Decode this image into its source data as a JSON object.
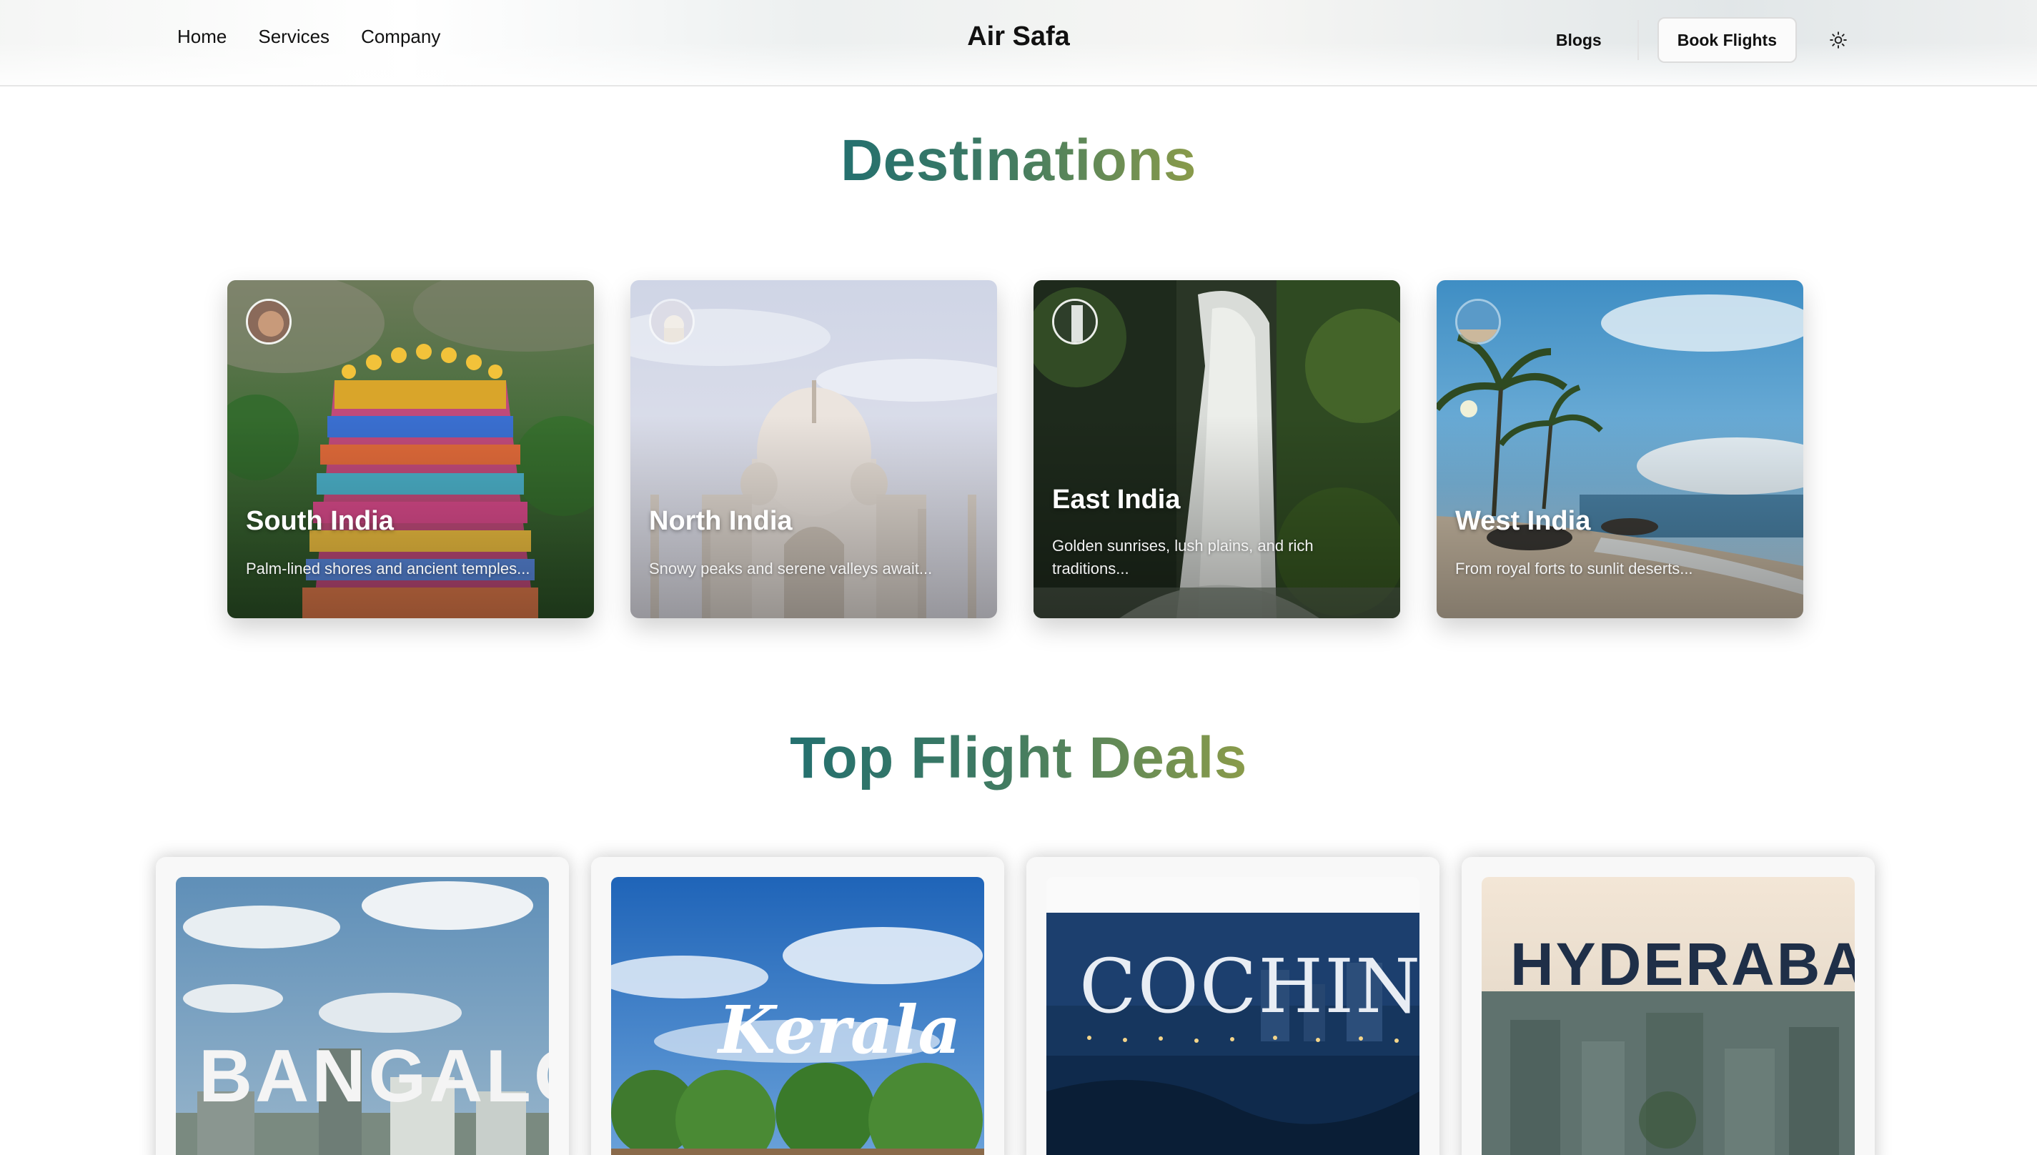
{
  "nav": {
    "links": [
      "Home",
      "Services",
      "Company"
    ],
    "brand": "Air Safa",
    "blogs": "Blogs",
    "book_flights": "Book Flights",
    "theme_icon": "sun-icon"
  },
  "destinations": {
    "title": "Destinations",
    "cards": [
      {
        "name": "South India",
        "desc": "Palm-lined shores and ancient temples..."
      },
      {
        "name": "North India",
        "desc": "Snowy peaks and serene valleys await..."
      },
      {
        "name": "East India",
        "desc": "Golden sunrises, lush plains, and rich traditions..."
      },
      {
        "name": "West India",
        "desc": "From royal forts to sunlit deserts..."
      }
    ]
  },
  "deals": {
    "title": "Top Flight Deals",
    "cards": [
      {
        "city": "BANGALO"
      },
      {
        "city": "Kerala"
      },
      {
        "city": "COCHIN"
      },
      {
        "city": "HYDERABAD"
      }
    ]
  },
  "colors": {
    "title_gradient_start": "#24706f",
    "title_gradient_end": "#8a9b4a"
  }
}
